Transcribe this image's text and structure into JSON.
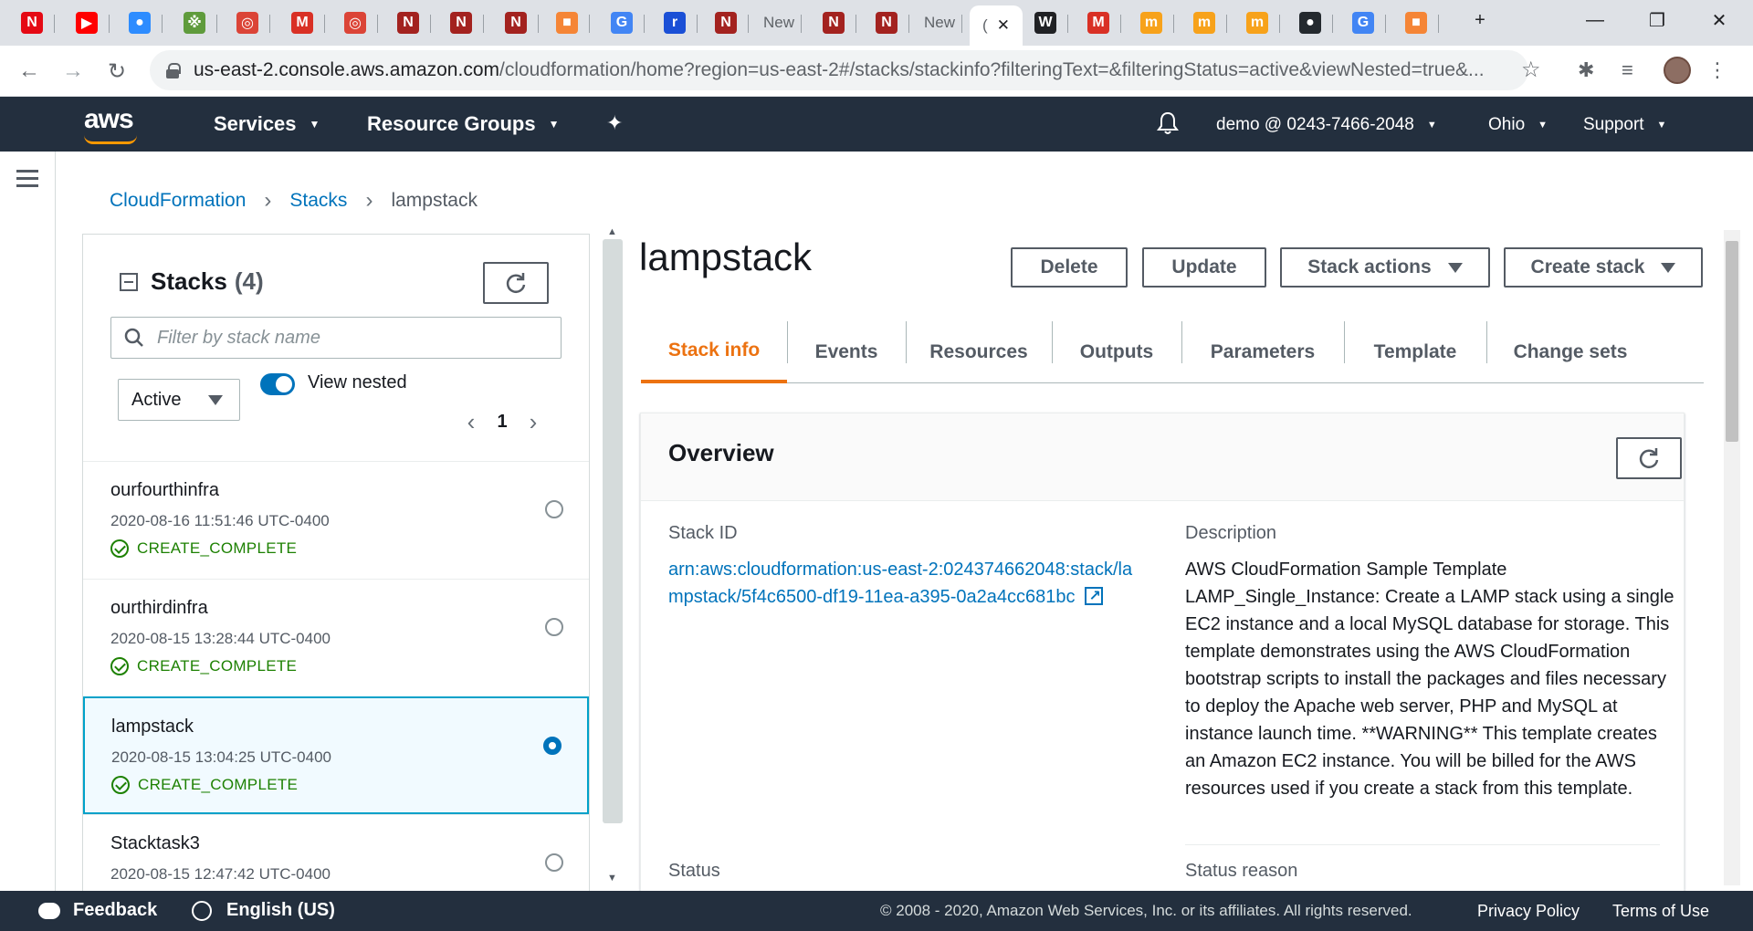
{
  "browser": {
    "tabs": [
      {
        "icon": "netflix-icon",
        "glyph": "N",
        "color": "#e50914"
      },
      {
        "icon": "youtube-icon",
        "glyph": "▶",
        "color": "#ff0000"
      },
      {
        "icon": "zoom-icon",
        "glyph": "●",
        "color": "#2d8cff"
      },
      {
        "icon": "app-icon",
        "glyph": "※",
        "color": "#5f9b3c"
      },
      {
        "icon": "chrome-icon",
        "glyph": "◎",
        "color": "#db4437"
      },
      {
        "icon": "gmail-icon",
        "glyph": "M",
        "color": "#d93025"
      },
      {
        "icon": "chrome-icon",
        "glyph": "◎",
        "color": "#db4437"
      },
      {
        "icon": "app-icon",
        "glyph": "N",
        "color": "#a3221f"
      },
      {
        "icon": "app-icon",
        "glyph": "N",
        "color": "#a3221f"
      },
      {
        "icon": "app-icon",
        "glyph": "N",
        "color": "#a3221f"
      },
      {
        "icon": "aws-box-icon",
        "glyph": "■",
        "color": "#f58536"
      },
      {
        "icon": "google-icon",
        "glyph": "G",
        "color": "#4285f4"
      },
      {
        "icon": "app-icon",
        "glyph": "r",
        "color": "#1a4fd6"
      },
      {
        "icon": "app-icon",
        "glyph": "N",
        "color": "#a3221f"
      },
      {
        "icon": "new-tab-label",
        "glyph": "New",
        "color": ""
      },
      {
        "icon": "app-icon",
        "glyph": "N",
        "color": "#a3221f"
      },
      {
        "icon": "app-icon",
        "glyph": "N",
        "color": "#a3221f"
      },
      {
        "icon": "new-tab-label",
        "glyph": "New",
        "color": ""
      },
      {
        "icon": "active-tab",
        "glyph": "(",
        "color": ""
      },
      {
        "icon": "wikipedia-icon",
        "glyph": "W",
        "color": "#202124"
      },
      {
        "icon": "gmail-icon",
        "glyph": "M",
        "color": "#d93025"
      },
      {
        "icon": "app-icon",
        "glyph": "m",
        "color": "#f7a21b"
      },
      {
        "icon": "app-icon",
        "glyph": "m",
        "color": "#f7a21b"
      },
      {
        "icon": "app-icon",
        "glyph": "m",
        "color": "#f7a21b"
      },
      {
        "icon": "github-icon",
        "glyph": "●",
        "color": "#24292e"
      },
      {
        "icon": "google-icon",
        "glyph": "G",
        "color": "#4285f4"
      },
      {
        "icon": "aws-box-icon",
        "glyph": "■",
        "color": "#f58536"
      }
    ],
    "new_tab": "+",
    "url_host": "us-east-2.console.aws.amazon.com",
    "url_path": "/cloudformation/home?region=us-east-2#/stacks/stackinfo?filteringText=&filteringStatus=active&viewNested=true&..."
  },
  "awsnav": {
    "logo": "aws",
    "services": "Services",
    "resource_groups": "Resource Groups",
    "account": "demo @ 0243-7466-2048",
    "region": "Ohio",
    "support": "Support"
  },
  "breadcrumb": {
    "items": [
      "CloudFormation",
      "Stacks"
    ],
    "current": "lampstack"
  },
  "stacks_panel": {
    "title": "Stacks",
    "count": "(4)",
    "filter_placeholder": "Filter by stack name",
    "status_filter": "Active",
    "view_nested_label": "View nested",
    "view_nested_on": true,
    "page": "1",
    "stacks": [
      {
        "name": "ourfourthinfra",
        "date": "2020-08-16 11:51:46 UTC-0400",
        "status": "CREATE_COMPLETE",
        "selected": false
      },
      {
        "name": "ourthirdinfra",
        "date": "2020-08-15 13:28:44 UTC-0400",
        "status": "CREATE_COMPLETE",
        "selected": false
      },
      {
        "name": "lampstack",
        "date": "2020-08-15 13:04:25 UTC-0400",
        "status": "CREATE_COMPLETE",
        "selected": true
      },
      {
        "name": "Stacktask3",
        "date": "2020-08-15 12:47:42 UTC-0400",
        "status": "",
        "selected": false
      }
    ]
  },
  "detail": {
    "title": "lampstack",
    "buttons": {
      "delete": "Delete",
      "update": "Update",
      "stack_actions": "Stack actions",
      "create_stack": "Create stack"
    },
    "tabs": [
      "Stack info",
      "Events",
      "Resources",
      "Outputs",
      "Parameters",
      "Template",
      "Change sets"
    ],
    "active_tab": "Stack info",
    "overview": {
      "title": "Overview",
      "stack_id_label": "Stack ID",
      "stack_id": "arn:aws:cloudformation:us-east-2:024374662048:stack/lampstack/5f4c6500-df19-11ea-a395-0a2a4cc681bc",
      "description_label": "Description",
      "description": "AWS CloudFormation Sample Template LAMP_Single_Instance: Create a LAMP stack using a single EC2 instance and a local MySQL database for storage. This template demonstrates using the AWS CloudFormation bootstrap scripts to install the packages and files necessary to deploy the Apache web server, PHP and MySQL at instance launch time. **WARNING** This template creates an Amazon EC2 instance. You will be billed for the AWS resources used if you create a stack from this template.",
      "status_label": "Status",
      "status_reason_label": "Status reason"
    }
  },
  "footer": {
    "feedback": "Feedback",
    "language": "English (US)",
    "copyright": "© 2008 - 2020, Amazon Web Services, Inc. or its affiliates. All rights reserved.",
    "privacy": "Privacy Policy",
    "terms": "Terms of Use"
  },
  "colors": {
    "aws_nav": "#232f3e",
    "aws_orange": "#ec7211",
    "link_blue": "#0073bb",
    "success_green": "#1d8102"
  }
}
